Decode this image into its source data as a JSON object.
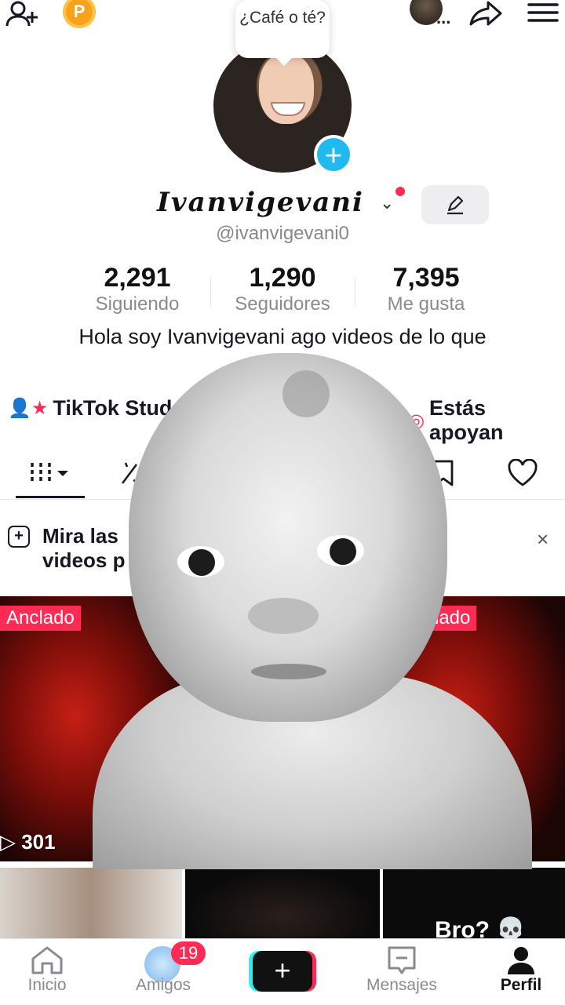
{
  "top_bar": {
    "coin_label": "P",
    "more_dots": "..."
  },
  "profile": {
    "bubble_text": "¿Café o té?",
    "display_name": "Ivanvigevani",
    "handle": "@ivanvigevani0",
    "stats": [
      {
        "value": "2,291",
        "label": "Siguiendo"
      },
      {
        "value": "1,290",
        "label": "Seguidores"
      },
      {
        "value": "7,395",
        "label": "Me gusta"
      }
    ],
    "bio": "Hola soy Ivanvigevani ago videos de lo que",
    "links": [
      {
        "label": "TikTok Stud"
      },
      {
        "label": "Estás apoyan"
      }
    ]
  },
  "banner": {
    "text_line1": "Mira las",
    "text_line2": "videos p",
    "close": "×"
  },
  "grid": {
    "pinned_left": "Anclado",
    "pinned_right": "clado",
    "views": "▷ 301",
    "bro_text": "Bro? 💀"
  },
  "bottom_nav": {
    "items": [
      {
        "label": "Inicio"
      },
      {
        "label": "Amigos"
      },
      {
        "label": "Mensajes"
      },
      {
        "label": "Perfil"
      }
    ],
    "create_label": "+",
    "friends_badge": "19"
  },
  "colors": {
    "accent": "#fe2c55",
    "cyan": "#25f4ee",
    "badge_blue": "#20b9f0"
  }
}
